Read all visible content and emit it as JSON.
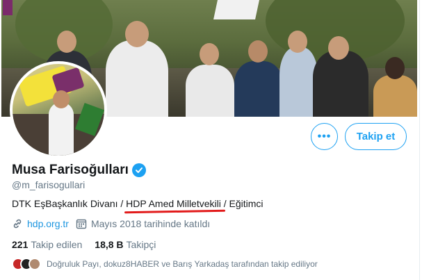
{
  "profile": {
    "name": "Musa Farisoğulları",
    "handle": "@m_farisogullari",
    "bio_part1": "DTK EşBaşkanlık Divanı / ",
    "bio_part2": "HDP Amed Milletvekili",
    "bio_part3": " / Eğitimci",
    "website": "hdp.org.tr",
    "joined": "Mayıs 2018 tarihinde katıldı"
  },
  "buttons": {
    "more_label": "•••",
    "follow_label": "Takip et"
  },
  "stats": {
    "following_count": "221",
    "following_label": "Takip edilen",
    "followers_count": "18,8 B",
    "followers_label": "Takipçi"
  },
  "followed_by": {
    "text": "Doğruluk Payı, dokuz8HABER ve Barış Yarkadaş tarafından takip ediliyor"
  },
  "icons": {
    "verified": "verified-badge-icon",
    "link": "link-icon",
    "calendar": "calendar-icon"
  },
  "colors": {
    "accent": "#1da1f2",
    "underline": "#e21b1b",
    "secondary_text": "#657786"
  }
}
